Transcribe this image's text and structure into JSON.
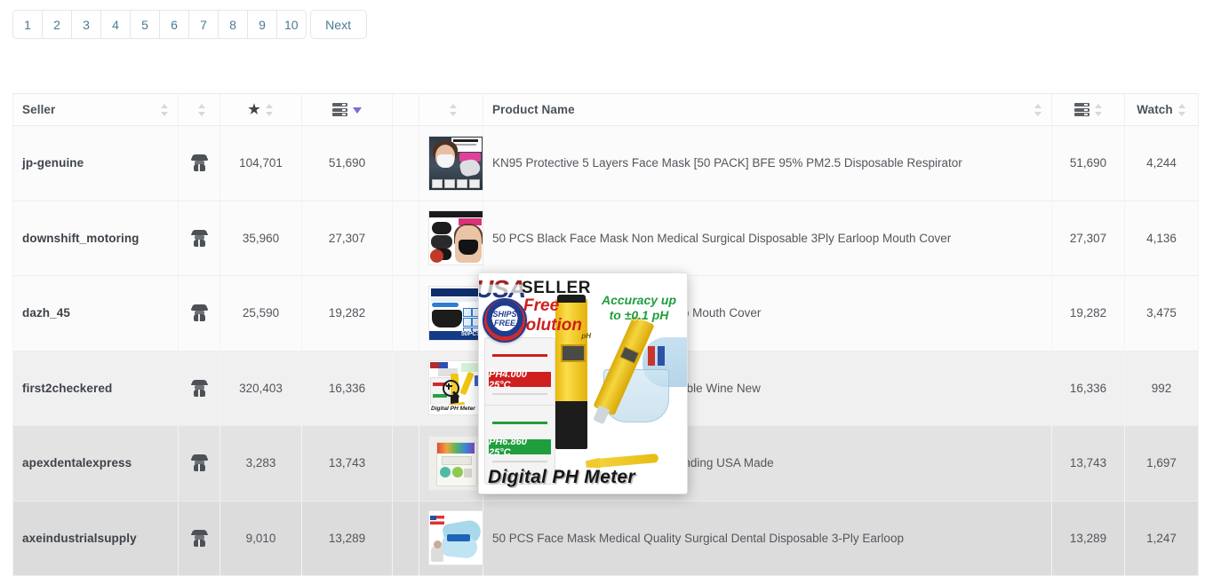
{
  "pagination": {
    "pages": [
      "1",
      "2",
      "3",
      "4",
      "5",
      "6",
      "7",
      "8",
      "9",
      "10"
    ],
    "next_label": "Next"
  },
  "table": {
    "headers": {
      "seller": "Seller",
      "spy_icon": "user-secret-icon",
      "star_icon": "star-icon",
      "server_icon": "server-stack-icon",
      "product_name": "Product Name",
      "server_icon_2": "server-stack-icon",
      "watch": "Watch"
    },
    "sort": {
      "active_column": "sold-count",
      "direction": "descending",
      "active_color": "#7a6ed0",
      "inactive_color": "#d5d8dc"
    },
    "rows": [
      {
        "seller": "jp-genuine",
        "feedback": "104,701",
        "sold": "51,690",
        "product_name": "KN95 Protective 5 Layers Face Mask [50 PACK] BFE 95% PM2.5 Disposable Respirator",
        "count": "51,690",
        "watch": "4,244",
        "thumb": "kn95-mask-woman-thumbnail"
      },
      {
        "seller": "downshift_motoring",
        "feedback": "35,960",
        "sold": "27,307",
        "product_name": "50 PCS Black Face Mask Non Medical Surgical Disposable 3Ply Earloop Mouth Cover",
        "count": "27,307",
        "watch": "4,136",
        "thumb": "black-face-mask-thumbnail"
      },
      {
        "seller": "dazh_45",
        "feedback": "25,590",
        "sold": "19,282",
        "product_name": "osable Non Medical Surgical Earloop Mouth Cover",
        "count": "19,282",
        "watch": "3,475",
        "thumb": "3-ply-disposable-protective-mask-thumbnail"
      },
      {
        "seller": "first2checkered",
        "feedback": "320,403",
        "sold": "16,336",
        "product_name": "c Pool Water Aquarium Pocket Portable Wine New",
        "count": "16,336",
        "watch": "992",
        "thumb": "digital-ph-meter-thumbnail"
      },
      {
        "seller": "apexdentalexpress",
        "feedback": "3,283",
        "sold": "13,743",
        "product_name": "ure Composite Kit 15gm/15gm & Bonding USA Made",
        "count": "13,743",
        "watch": "1,697",
        "thumb": "dental-composite-kit-thumbnail"
      },
      {
        "seller": "axeindustrialsupply",
        "feedback": "9,010",
        "sold": "13,289",
        "product_name": "50 PCS Face Mask Medical Quality Surgical Dental Disposable 3-Ply Earloop",
        "count": "13,289",
        "watch": "1,247",
        "thumb": "blue-surgical-mask-thumbnail"
      }
    ]
  },
  "preview_popup": {
    "usa_text": "USA",
    "seller_text": "SELLER",
    "free_text": "Free",
    "solution_text": "Solution",
    "ships_free_text": "SHIPS FREE",
    "accuracy_text": "Accuracy up to ±0.1 pH",
    "card_1_label": "PH4.000 25°C",
    "card_2_label": "PH6.860 25°C",
    "title": "Digital PH Meter"
  },
  "cursor": {
    "icon": "magnifier-zoom-in-cursor"
  }
}
